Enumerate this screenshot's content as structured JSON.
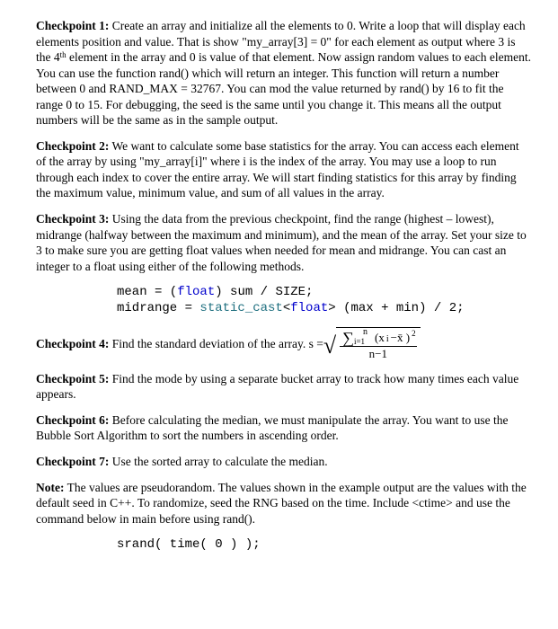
{
  "cp1": {
    "label": "Checkpoint 1:",
    "text": " Create an array and initialize all the elements to 0.  Write a loop that will display each elements position and value.  That is show \"my_array[3] = 0\" for each element as output where 3 is the 4",
    "sup": "th",
    "text2": " element in the array and 0 is value of that element.  Now assign random values to each element.  You can use the function rand() which will return an integer.  This function will return a number between 0 and RAND_MAX = 32767.  You can mod the value returned by rand() by 16 to fit the range 0 to 15.  For debugging, the seed is the same until you change it.  This means all the output numbers will be the same as in the sample output."
  },
  "cp2": {
    "label": "Checkpoint 2:",
    "text": " We want to calculate some base statistics for the array.  You can access each element of the array by using \"my_array[i]\" where i is the index of the array.  You may use a loop to run through each index to cover the entire array.  We will start finding statistics for this array by finding the maximum value, minimum value, and sum of all values in the array."
  },
  "cp3": {
    "label": "Checkpoint 3:",
    "text": " Using the data from the previous checkpoint, find the range (highest – lowest), midrange (halfway between the maximum and minimum), and the mean of the array.  Set your size to 3 to make sure you are getting float values when needed for mean and midrange.  You can cast an integer to a float using either of the following methods."
  },
  "code": {
    "line1a": "mean = (",
    "line1b": "float",
    "line1c": ") sum / SIZE;",
    "line2a": "midrange = ",
    "line2b": "static_cast",
    "line2c": "<",
    "line2d": "float",
    "line2e": "> (max + min) / 2;"
  },
  "cp4": {
    "label": "Checkpoint 4:",
    "text": " Find the standard deviation of the array.  s = ",
    "formula": {
      "sum_top": "n",
      "sum_bottom": "i=1",
      "xi": "(x",
      "isub": "i",
      "minus": "−x̄ )",
      "sq": "2",
      "den": "n−1"
    }
  },
  "cp5": {
    "label": "Checkpoint 5:",
    "text": " Find the mode by using a separate bucket array to track how many times each value appears."
  },
  "cp6": {
    "label": "Checkpoint 6:",
    "text": " Before calculating the median, we must manipulate the array.  You want to use the Bubble Sort Algorithm to sort the numbers in ascending order."
  },
  "cp7": {
    "label": "Checkpoint 7:",
    "text": " Use the sorted array to calculate the median."
  },
  "note": {
    "label": "Note:",
    "text": " The values are pseudorandom.  The values shown in the example output are the values with the default seed in C++. To randomize, seed the RNG based on the time. Include <ctime> and use the command below in main before using rand()."
  },
  "srand": "srand( time( 0 ) );"
}
